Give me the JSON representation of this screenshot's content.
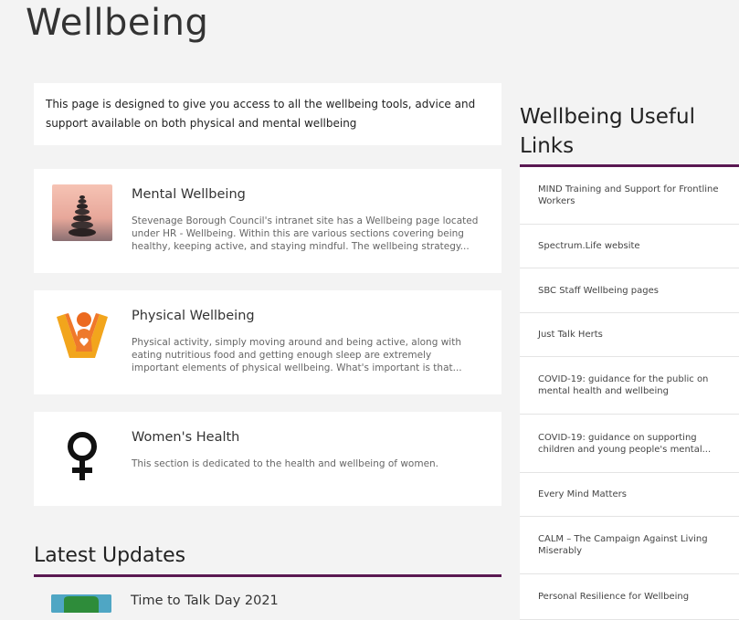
{
  "page": {
    "title": "Wellbeing"
  },
  "intro": {
    "text": "This page is designed to give you access to all the wellbeing tools, advice and support available on both physical and mental wellbeing"
  },
  "cards": [
    {
      "title": "Mental Wellbeing",
      "description": "Stevenage Borough Council's intranet site has a Wellbeing page located under HR - Wellbeing. Within this are various sections covering being healthy, keeping active, and staying mindful. The wellbeing strategy...",
      "icon": "stacked-stones-icon"
    },
    {
      "title": "Physical Wellbeing",
      "description": "Physical activity, simply moving around and being active, along with eating nutritious food and getting enough sleep are extremely important elements of physical wellbeing. What's important is that...",
      "icon": "person-heart-icon"
    },
    {
      "title": "Women's Health",
      "description": "This section is dedicated to the health and wellbeing of women.",
      "icon": "female-symbol-icon"
    }
  ],
  "latest_updates": {
    "heading": "Latest Updates",
    "items": [
      {
        "title": "Time to Talk Day 2021"
      }
    ]
  },
  "sidebar": {
    "heading": "Wellbeing Useful Links",
    "links": [
      "MIND Training and Support for Frontline Workers",
      "Spectrum.Life website",
      "SBC Staff Wellbeing pages",
      "Just Talk Herts",
      "COVID-19: guidance for the public on mental health and wellbeing",
      "COVID-19: guidance on supporting children and young people's mental...",
      "Every Mind Matters",
      "CALM – The Campaign Against Living Miserably",
      "Personal Resilience for Wellbeing"
    ]
  },
  "colors": {
    "accent": "#5a1852",
    "background": "#f3f3f3",
    "card": "#ffffff"
  }
}
